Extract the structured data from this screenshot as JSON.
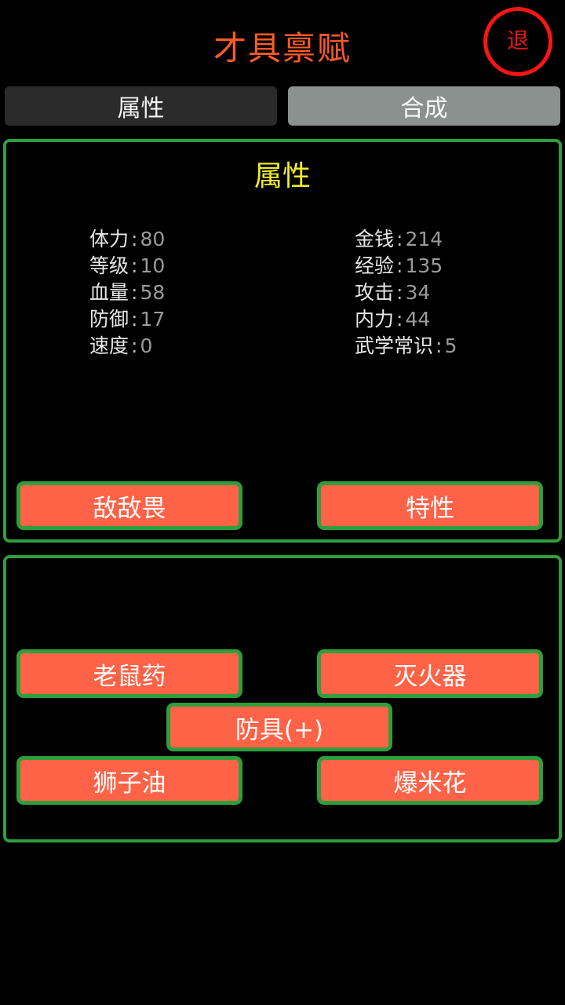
{
  "header": {
    "title": "才具禀赋",
    "exit_label": "退"
  },
  "tabs": [
    {
      "label": "属性",
      "active": true
    },
    {
      "label": "合成",
      "active": false
    }
  ],
  "attributes": {
    "title": "属性",
    "separator": ":",
    "left": [
      {
        "label": "体力",
        "value": "80"
      },
      {
        "label": "等级",
        "value": "10"
      },
      {
        "label": "血量",
        "value": "58"
      },
      {
        "label": "防御",
        "value": "17"
      },
      {
        "label": "速度",
        "value": "0"
      }
    ],
    "right": [
      {
        "label": "金钱",
        "value": "214"
      },
      {
        "label": "经验",
        "value": "135"
      },
      {
        "label": "攻击",
        "value": "34"
      },
      {
        "label": "内力",
        "value": "44"
      },
      {
        "label": "武学常识",
        "value": "5"
      }
    ],
    "buttons": {
      "enemy": "敌敌畏",
      "traits": "特性"
    }
  },
  "items": {
    "rat_poison": "老鼠药",
    "extinguisher": "灭火器",
    "armor": "防具(+)",
    "lion_oil": "狮子油",
    "popcorn": "爆米花"
  },
  "colors": {
    "title": "#ff5a26",
    "exit_ring": "#ff1414",
    "panel_border": "#2f9e3b",
    "button_fill": "#ff6347",
    "section_title": "#f1ee2c"
  }
}
